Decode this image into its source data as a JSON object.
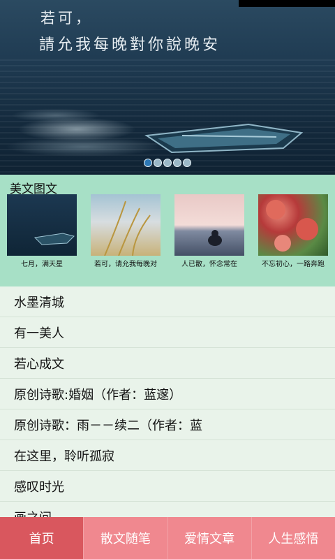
{
  "banner": {
    "line1": "若可，",
    "line2": "請允我每晚對你說晚安",
    "dots": [
      true,
      false,
      false,
      false,
      false
    ]
  },
  "section": {
    "title": "美文图文",
    "items": [
      {
        "caption": "七月，满天星"
      },
      {
        "caption": "若可，请允我每晚对"
      },
      {
        "caption": "人已散，怀念常在"
      },
      {
        "caption": "不忘初心，一路奔跑"
      }
    ]
  },
  "list": [
    "水墨清城",
    "有一美人",
    "若心成文",
    "原创诗歌:婚姻（作者：蓝邃）",
    "原创诗歌：雨－－续二（作者：蓝",
    "在这里，聆听孤寂",
    "感叹时光",
    "画之间"
  ],
  "nav": {
    "tabs": [
      "首页",
      "散文随笔",
      "爱情文章",
      "人生感悟"
    ],
    "active": 0
  },
  "colors": {
    "section_bg": "#a7e0c6",
    "list_bg": "#e9f3ea",
    "nav_bg": "#f0888f",
    "nav_active": "#d9575e"
  }
}
